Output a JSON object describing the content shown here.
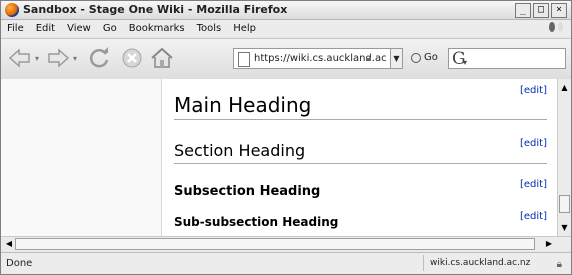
{
  "window": {
    "title": "Sandbox - Stage One Wiki - Mozilla Firefox",
    "controls": [
      "_",
      "□",
      "×"
    ]
  },
  "menu": [
    "File",
    "Edit",
    "View",
    "Go",
    "Bookmarks",
    "Tools",
    "Help"
  ],
  "toolbar": {
    "url": "https://wiki.cs.auckland.ac",
    "go_label": "Go",
    "search_value": ""
  },
  "icons": {
    "back": "back-arrow-icon",
    "forward": "forward-arrow-icon",
    "reload": "reload-icon",
    "stop": "stop-icon",
    "home": "home-icon",
    "page": "page-icon",
    "lock": "padlock-icon",
    "search_engine": "google-g-icon"
  },
  "page": {
    "headings": [
      {
        "text": "Main Heading",
        "level": 1,
        "edit": "[edit]"
      },
      {
        "text": "Section Heading",
        "level": 2,
        "edit": "[edit]"
      },
      {
        "text": "Subsection Heading",
        "level": 3,
        "edit": "[edit]"
      },
      {
        "text": "Sub-subsection Heading",
        "level": 4,
        "edit": "[edit]"
      }
    ]
  },
  "status": {
    "text": "Done",
    "host": "wiki.cs.auckland.ac.nz"
  },
  "colors": {
    "edit_link": "#002bb8",
    "rule": "#aaaaaa"
  }
}
